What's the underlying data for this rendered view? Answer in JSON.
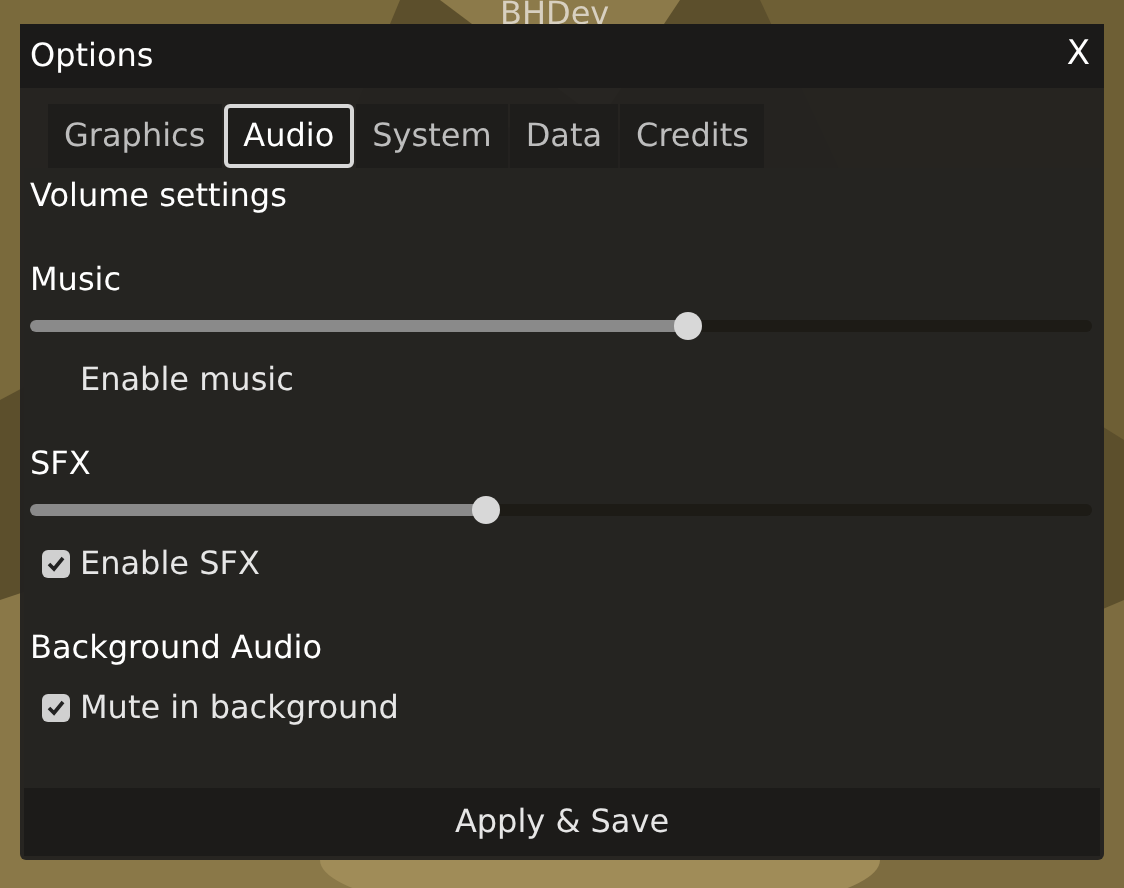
{
  "background": {
    "title": "BHDev"
  },
  "window": {
    "title": "Options",
    "close": "X"
  },
  "tabs": [
    {
      "label": "Graphics",
      "selected": false
    },
    {
      "label": "Audio",
      "selected": true
    },
    {
      "label": "System",
      "selected": false
    },
    {
      "label": "Data",
      "selected": false
    },
    {
      "label": "Credits",
      "selected": false
    }
  ],
  "section_title": "Volume settings",
  "groups": [
    {
      "title": "Music",
      "level": 0.62,
      "checkbox": {
        "label": "Enable music",
        "checked": false
      }
    },
    {
      "title": "SFX",
      "level": 0.43,
      "checkbox": {
        "label": "Enable SFX",
        "checked": true
      }
    },
    {
      "title": "Background Audio",
      "checkbox": {
        "label": "Mute in background",
        "checked": true
      }
    }
  ],
  "apply_button": "Apply & Save"
}
